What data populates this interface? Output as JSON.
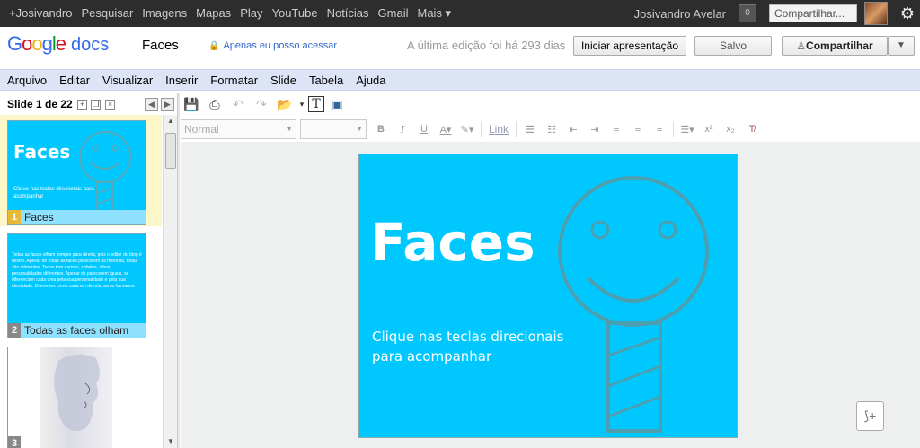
{
  "gbar": {
    "links": [
      "+Josivandro",
      "Pesquisar",
      "Imagens",
      "Mapas",
      "Play",
      "YouTube",
      "Notícias",
      "Gmail",
      "Mais ▾"
    ],
    "user": "Josivandro Avelar",
    "notifications": "0",
    "share": "Compartilhar..."
  },
  "header": {
    "logo_google": "Google",
    "logo_docs": "docs",
    "title": "Faces",
    "privacy": "Apenas eu posso acessar",
    "last_edit": "A última edição foi há 293 dias",
    "present_btn": "Iniciar apresentação",
    "saved_btn": "Salvo",
    "share_btn": "Compartilhar"
  },
  "menu": [
    "Arquivo",
    "Editar",
    "Visualizar",
    "Inserir",
    "Formatar",
    "Slide",
    "Tabela",
    "Ajuda"
  ],
  "sidebar": {
    "slide_count": "Slide 1 de 22",
    "slides": [
      {
        "num": "1",
        "name": "Faces",
        "title": "Faces",
        "subtitle": "Clique nas teclas direcionais para acompanhar"
      },
      {
        "num": "2",
        "name": "Todas as faces olham",
        "text": "Todas as faces olham sempre para direita, pois o editor do blog é destro. Apesar de todas as faces parecerem as mesmas, todas são diferentes. Todas tem narizes, cabelos, olhos, personalidades diferentes. Apesar de parecerem iguais, se diferenciam cada uma pela sua personalidade e pela sua identidade. Diferentes como cada um de nós, seres humanos."
      },
      {
        "num": "3",
        "name": ""
      }
    ]
  },
  "formatbar": {
    "style": "Normal",
    "font": "",
    "link": "Link"
  },
  "slide": {
    "title": "Faces",
    "subtitle_line1": "Clique nas teclas direcionais",
    "subtitle_line2": "para acompanhar"
  },
  "colors": {
    "slide_bg": "#00c8ff",
    "gbar_bg": "#2d2d2d",
    "menubar_bg": "#dde4f6"
  }
}
